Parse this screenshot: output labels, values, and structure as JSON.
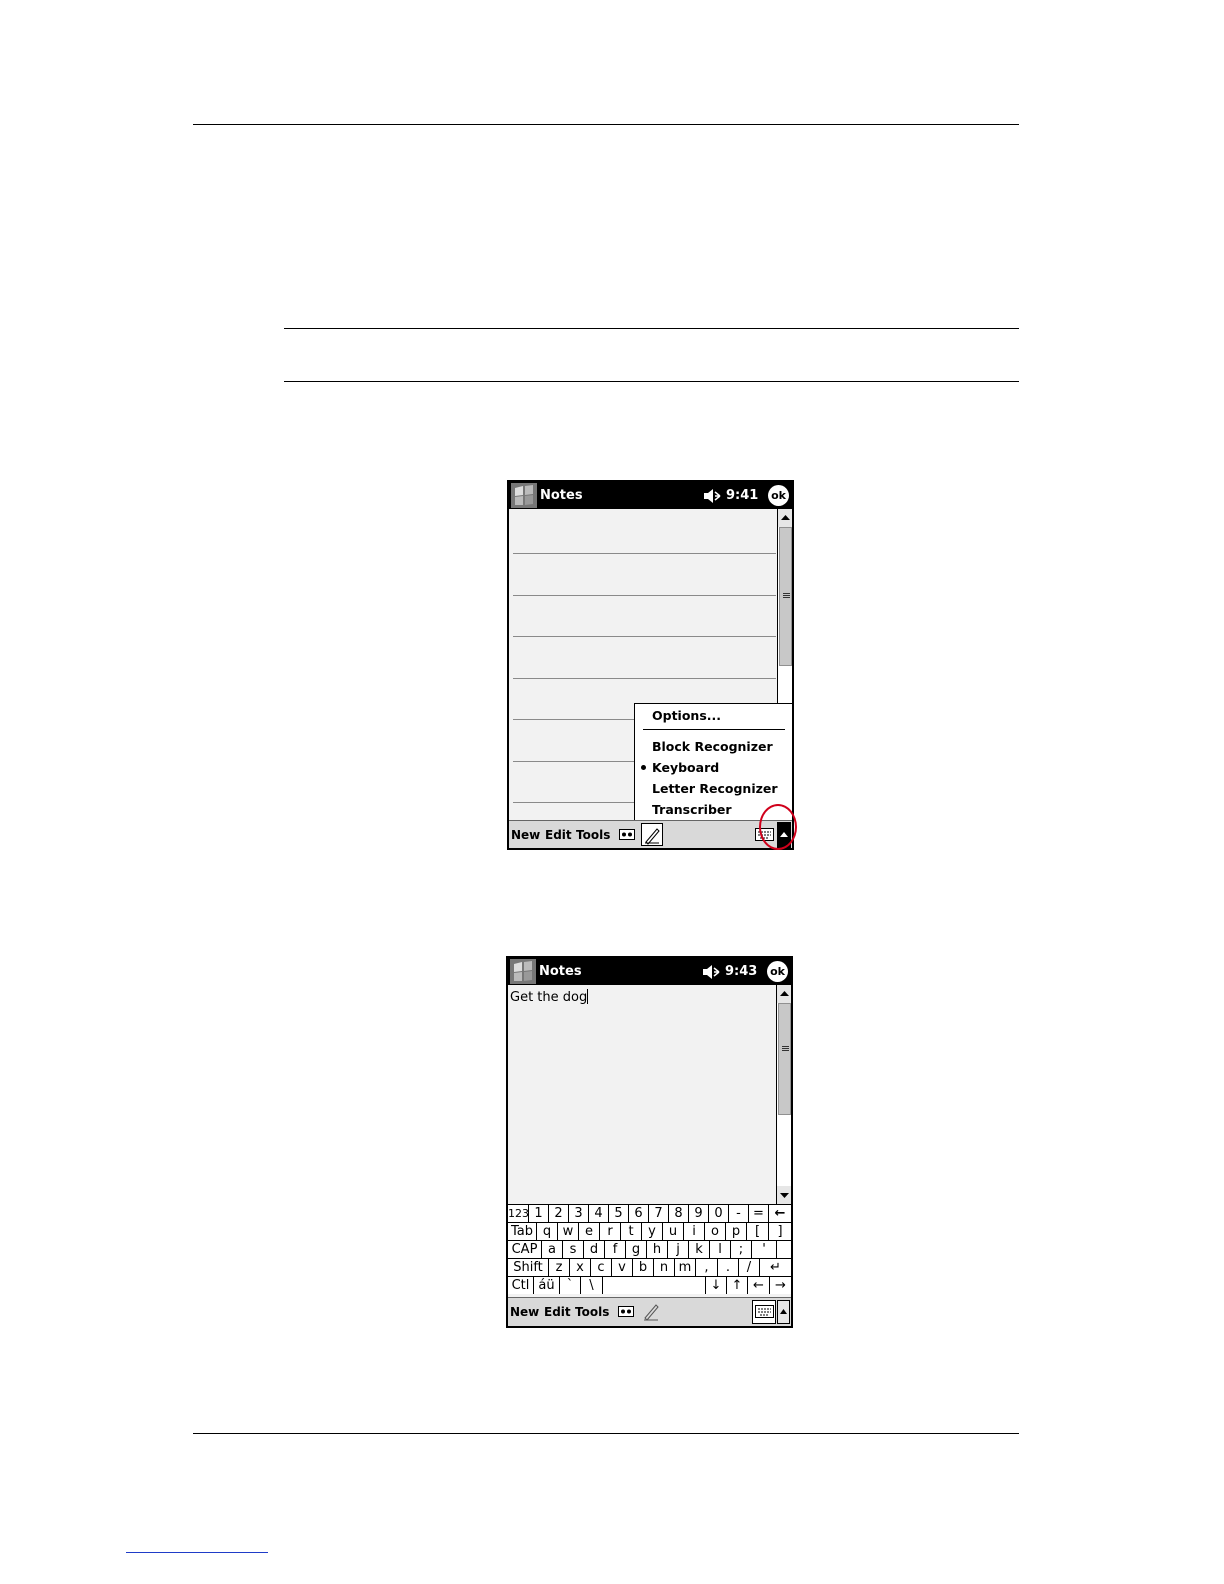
{
  "screen1": {
    "title": "Notes",
    "time": "9:41",
    "ok_label": "ok",
    "menu": {
      "new": "New",
      "edit": "Edit",
      "tools": "Tools"
    },
    "popup": {
      "options": "Options...",
      "items": [
        "Block Recognizer",
        "Keyboard",
        "Letter Recognizer",
        "Transcriber"
      ],
      "selected": "Keyboard"
    },
    "highlight_color": "#d0001b"
  },
  "screen2": {
    "title": "Notes",
    "time": "9:43",
    "ok_label": "ok",
    "note_text": "Get the dog",
    "menu": {
      "new": "New",
      "edit": "Edit",
      "tools": "Tools"
    },
    "keyboard": {
      "row1": [
        "123",
        "1",
        "2",
        "3",
        "4",
        "5",
        "6",
        "7",
        "8",
        "9",
        "0",
        "-",
        "=",
        "←"
      ],
      "row2": [
        "Tab",
        "q",
        "w",
        "e",
        "r",
        "t",
        "y",
        "u",
        "i",
        "o",
        "p",
        "[",
        "]"
      ],
      "row3": [
        "CAP",
        "a",
        "s",
        "d",
        "f",
        "g",
        "h",
        "j",
        "k",
        "l",
        ";",
        "'"
      ],
      "row4": [
        "Shift",
        "z",
        "x",
        "c",
        "v",
        "b",
        "n",
        "m",
        ",",
        ".",
        "/",
        "↵"
      ],
      "row5": [
        "Ctl",
        "áü",
        "`",
        "\\",
        "",
        "↓",
        "↑",
        "←",
        "→"
      ]
    }
  },
  "icons": [
    "windows-start-icon",
    "speaker-muted-icon",
    "keyboard-icon",
    "pen-icon",
    "recorder-icon",
    "up-arrow-icon"
  ]
}
